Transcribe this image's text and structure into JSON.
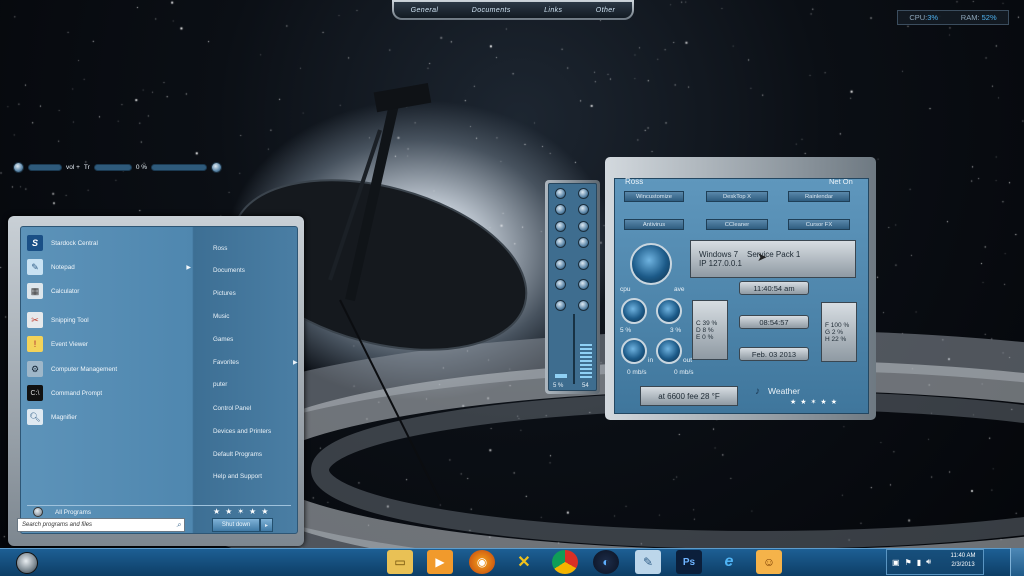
{
  "top_menu": {
    "items": [
      "General",
      "Documents",
      "Links",
      "Other"
    ]
  },
  "sysmon": {
    "cpu_label": "CPU:",
    "cpu_value": "3%",
    "ram_label": "RAM:",
    "ram_value": "52%"
  },
  "start_menu": {
    "programs": [
      {
        "label": "Stardock Central",
        "icon": "stardock-icon",
        "arrow": false
      },
      {
        "label": "Notepad",
        "icon": "notepad-icon",
        "arrow": true
      },
      {
        "label": "Calculator",
        "icon": "calculator-icon",
        "arrow": false
      },
      {
        "label": "Snipping Tool",
        "icon": "snipping-tool-icon",
        "arrow": false
      },
      {
        "label": "Event Viewer",
        "icon": "event-viewer-icon",
        "arrow": false
      },
      {
        "label": "Computer Management",
        "icon": "computer-management-icon",
        "arrow": false
      },
      {
        "label": "Command Prompt",
        "icon": "command-prompt-icon",
        "arrow": false
      },
      {
        "label": "Magnifier",
        "icon": "magnifier-icon",
        "arrow": false
      }
    ],
    "places": [
      {
        "label": "Ross",
        "arrow": false
      },
      {
        "label": "Documents",
        "arrow": false
      },
      {
        "label": "Pictures",
        "arrow": false
      },
      {
        "label": "Music",
        "arrow": false
      },
      {
        "label": "Games",
        "arrow": false
      },
      {
        "label": "Favorites",
        "arrow": true
      },
      {
        "label": "puter",
        "arrow": false
      },
      {
        "label": "Control Panel",
        "arrow": false
      },
      {
        "label": "Devices and Printers",
        "arrow": false
      },
      {
        "label": "Default Programs",
        "arrow": false
      },
      {
        "label": "Help and Support",
        "arrow": false
      }
    ],
    "all_programs": "All Programs",
    "search_placeholder": "Search programs and files",
    "shutdown_label": "Shut down"
  },
  "mixer": {
    "left_value": "5 %",
    "right_value": "54"
  },
  "gadget": {
    "vol_label": "vol +",
    "tr_label": "Tr",
    "percent": "0 %",
    "user": "Ross",
    "net_status": "Net On",
    "buttons_row1": [
      "Wincustomize",
      "DeskTop X",
      "Rainlendar"
    ],
    "buttons_row2": [
      "Antivirus",
      "CCleaner",
      "Cursor FX"
    ],
    "os_line1": "Windows 7",
    "os_line2": "Service Pack 1",
    "ip": "IP 127.0.0.1",
    "time1": "11:40:54 am",
    "time2": "08:54:57",
    "date": "Feb. 03 2013",
    "cpu_label": "cpu",
    "ave_label": "ave",
    "cpu_pct": "5 %",
    "ave_pct": "3 %",
    "in_label": "in",
    "out_label": "out",
    "in_rate": "0 mb/s",
    "out_rate": "0 mb/s",
    "left_drive_letters": [
      "C",
      "D",
      "E"
    ],
    "left_drive_values": [
      "39 %",
      "8 %",
      "0 %"
    ],
    "right_drive_letters": [
      "F",
      "G",
      "H"
    ],
    "right_drive_values": [
      "100 %",
      "2 %",
      "22 %"
    ],
    "weather_temp_text": "at 6600 fee 28 °F",
    "weather_label": "Weather"
  },
  "taskbar": {
    "icons": [
      "explorer-icon",
      "media-player-icon",
      "firefox-icon",
      "x-tool-icon",
      "chrome-icon",
      "app-swirl-icon",
      "notepad-taskbar-icon",
      "photoshop-icon",
      "internet-explorer-icon",
      "extra-app-icon"
    ],
    "clock_time": "11:40 AM",
    "clock_date": "2/3/2013"
  }
}
